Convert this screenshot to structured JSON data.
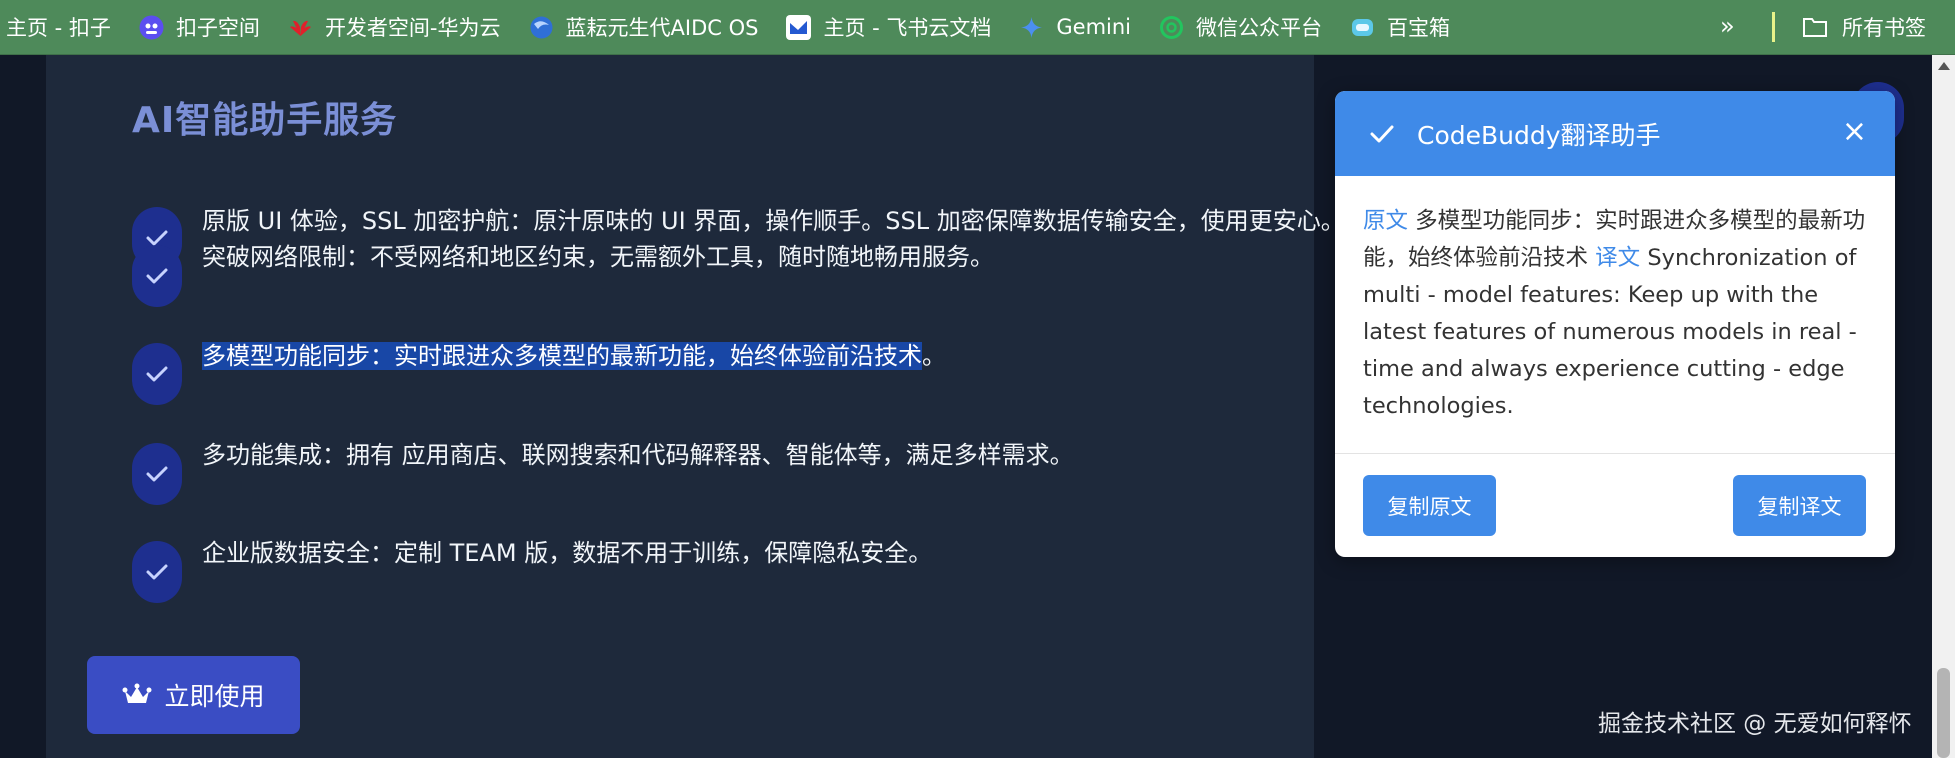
{
  "bookmarks": {
    "items": [
      {
        "label": "主页 - 扣子",
        "icon": "none"
      },
      {
        "label": "扣子空间",
        "icon": "coze-icon"
      },
      {
        "label": "开发者空间-华为云",
        "icon": "huawei-icon"
      },
      {
        "label": "蓝耘元生代AIDC OS",
        "icon": "lanyun-icon"
      },
      {
        "label": "主页 - 飞书云文档",
        "icon": "feishu-icon"
      },
      {
        "label": "Gemini",
        "icon": "gemini-icon"
      },
      {
        "label": "微信公众平台",
        "icon": "wechat-icon"
      },
      {
        "label": "百宝箱",
        "icon": "baibaoxiang-icon"
      }
    ],
    "more": "»",
    "all_bookmarks": "所有书签"
  },
  "main": {
    "heading": "AI智能助手服务",
    "features": [
      {
        "text": "原版 UI 体验，SSL 加密护航：原汁原味的 UI 界面，操作顺手。SSL 加密保障数据传输安全，使用更安心。"
      },
      {
        "text": "突破网络限制：不受网络和地区约束，无需额外工具，随时随地畅用服务。"
      },
      {
        "highlighted": "多模型功能同步：实时跟进众多模型的最新功能，始终体验前沿技术",
        "rest": "。"
      },
      {
        "text": "多功能集成：拥有 应用商店、联网搜索和代码解释器、智能体等，满足多样需求。"
      },
      {
        "text": "企业版数据安全：定制 TEAM 版，数据不用于训练，保障隐私安全。"
      }
    ],
    "cta_label": "立即使用"
  },
  "popup": {
    "title": "CodeBuddy翻译助手",
    "close": "×",
    "original_label": "原文",
    "original_text": "多模型功能同步：实时跟进众多模型的最新功能，始终体验前沿技术",
    "translation_label": "译文",
    "translation_text": "Synchronization of multi - model features: Keep up with the latest features of numerous models in real - time and always experience cutting - edge technologies.",
    "copy_original": "复制原文",
    "copy_translation": "复制译文"
  },
  "watermark": "掘金技术社区 @ 无爱如何释怀",
  "colors": {
    "bookmark_bar": "#4e8a5a",
    "page_bg": "#111827",
    "panel_bg": "#1e293b",
    "accent": "#3f8ae8",
    "badge": "#1e2f8f",
    "cta": "#3a4dc4"
  }
}
